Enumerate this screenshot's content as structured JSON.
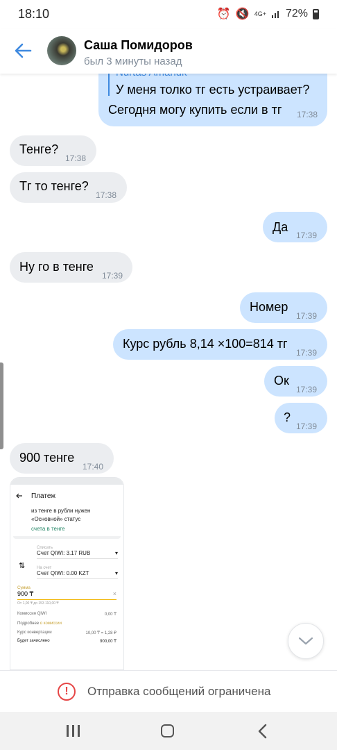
{
  "status_bar": {
    "time": "18:10",
    "network": "4G+",
    "battery": "72%"
  },
  "header": {
    "name": "Саша Помидоров",
    "status": "был 3 минуты назад"
  },
  "reply": {
    "author": "Nurtas Amandk",
    "quote": "У меня толко тг есть устраивает?",
    "text": "Сегодня могу купить если в тг",
    "time": "17:38"
  },
  "messages": [
    {
      "dir": "in",
      "text": "Тенге?",
      "time": "17:38"
    },
    {
      "dir": "in",
      "text": "Тг то тенге?",
      "time": "17:38"
    },
    {
      "dir": "out",
      "text": "Да",
      "time": "17:39"
    },
    {
      "dir": "in",
      "text": "Ну го в тенге",
      "time": "17:39"
    },
    {
      "dir": "out",
      "text": "Номер",
      "time": "17:39"
    },
    {
      "dir": "out",
      "text": "Курс рубль 8,14 ×100=814 тг",
      "time": "17:39"
    },
    {
      "dir": "out",
      "text": "Ок",
      "time": "17:39"
    },
    {
      "dir": "out",
      "text": "?",
      "time": "17:39"
    },
    {
      "dir": "in",
      "text": "900 тенге",
      "time": "17:40"
    }
  ],
  "attachment": {
    "title": "Платеж",
    "info_line1": "из тенге в рубли нужен",
    "info_line2": "«Основной» статус",
    "link": "счета в тенге",
    "from_label": "Списать",
    "from_account": "Счет QIWI: 3.17 RUB",
    "to_label": "На счет",
    "to_account": "Счет QIWI: 0.00 KZT",
    "amount_label": "Сумма",
    "amount": "900 ₸",
    "limits": "От 1,00 ₸ до 153 110,00 ₸",
    "commission_label": "Комиссия QIWI",
    "commission_value": "0,00 ₸",
    "details_prefix": "Подробнее",
    "details_link": "о комиссии",
    "rate_label": "Курс конвертации",
    "rate_value": "10,00 ₸ = 1,28 ₽",
    "debit_label": "Будет зачислено",
    "debit_value": "900,00 ₸"
  },
  "footer": {
    "restricted": "Отправка сообщений ограничена"
  },
  "colors": {
    "accent": "#3f8ae0",
    "incoming": "#ebedf0",
    "outgoing": "#cce4ff",
    "warning": "#e64646"
  }
}
